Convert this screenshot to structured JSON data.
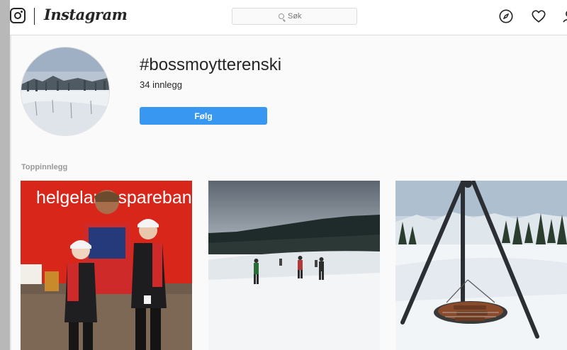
{
  "header": {
    "logo_text": "Instagram",
    "search_placeholder": "Søk"
  },
  "profile": {
    "hashtag": "#bossmoytterenski",
    "post_count": "34 innlegg",
    "follow_label": "Følg"
  },
  "section": {
    "top_posts_label": "Toppinnlegg"
  },
  "photos": [
    {
      "banner_text": "helgeland sparebank"
    },
    {},
    {}
  ],
  "colors": {
    "follow_button": "#3897f0",
    "banner_red": "#e2231a"
  }
}
